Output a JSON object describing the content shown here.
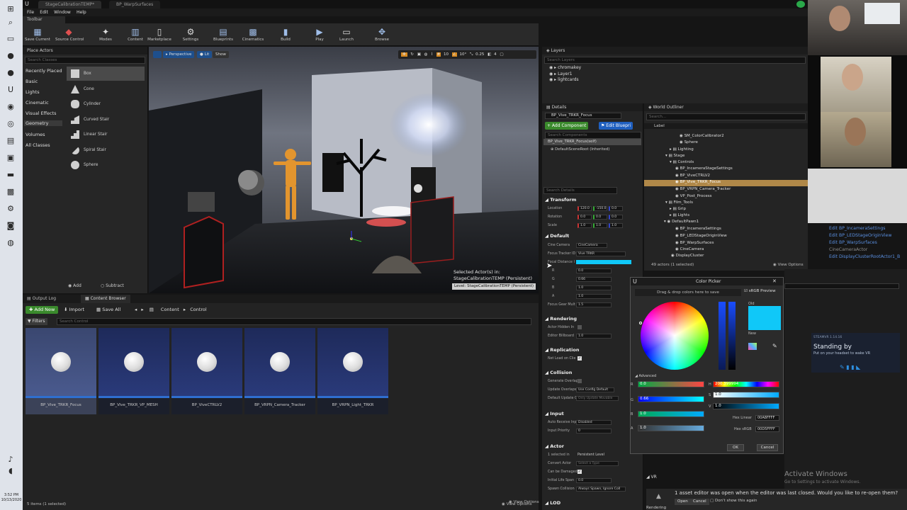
{
  "window": {
    "tabs": [
      "StageCalibrationTEMP*",
      "BP_WarpSurfaces"
    ],
    "menu": [
      "File",
      "Edit",
      "Window",
      "Help"
    ],
    "toolbar_tab": "Toolbar"
  },
  "toolbar": {
    "buttons": [
      "Save Current",
      "Source Control",
      "Modes",
      "Content",
      "Marketplace",
      "Settings",
      "Blueprints",
      "Cinematics",
      "Build",
      "Play",
      "Launch",
      "Browse"
    ]
  },
  "place_actors": {
    "title": "Place Actors",
    "search_placeholder": "Search Classes",
    "categories": [
      "Recently Placed",
      "Basic",
      "Lights",
      "Cinematic",
      "Visual Effects",
      "Geometry",
      "Volumes",
      "All Classes"
    ],
    "selected_category": "Geometry",
    "items": [
      "Box",
      "Cone",
      "Cylinder",
      "Curved Stair",
      "Linear Stair",
      "Spiral Stair",
      "Sphere"
    ],
    "add_label": "Add",
    "subtract_label": "Subtract"
  },
  "viewport": {
    "perspective": "Perspective",
    "lit": "Lit",
    "show": "Show",
    "grid_snap": "10",
    "rot_snap": "10°",
    "scale_snap": "0.25",
    "cam_speed": "4",
    "selected_label": "Selected Actor(s) in:",
    "selected_value": "StageCalibrationTEMP (Persistent)",
    "level_label": "Level: StageCalibrationTEMP (Persistent)"
  },
  "bottom": {
    "tabs": [
      "Output Log",
      "Content Browser"
    ],
    "add_new": "Add New",
    "import": "Import",
    "save_all": "Save All",
    "path": [
      "Content",
      "Control"
    ],
    "filters": "Filters",
    "search_placeholder": "Search Control",
    "assets": [
      "BP_Vive_TRKR_Focus",
      "BP_Vive_TRKR_VP_MESH",
      "BP_ViveCTRLV2",
      "BP_VRPN_Camera_Tracker",
      "BP_VRPN_Light_TRKR"
    ],
    "status": "5 items (1 selected)",
    "view_options": "View Options"
  },
  "layers": {
    "title": "Layers",
    "search_placeholder": "Search Layers",
    "items": [
      "chromakey",
      "Layer1",
      "lightcards"
    ]
  },
  "details": {
    "title": "Details",
    "actor_name": "BP_Vive_TRKR_Focus",
    "add_component": "+ Add Component",
    "edit_blueprint": "Edit Bluepri",
    "search_components": "Search Components",
    "self_row": "BP_Vive_TRKR_Focus(self)",
    "root_row": "DefaultSceneRoot (Inherited)",
    "search_details": "Search Details",
    "sections": [
      "Transform",
      "Default",
      "Rendering",
      "Replication",
      "Collision",
      "Input",
      "Actor",
      "LOD"
    ],
    "transform": {
      "labels": [
        "Location",
        "Rotation",
        "Scale"
      ],
      "location": [
        "120.0",
        "-150.0",
        "0.0"
      ],
      "rotation": [
        "0.0",
        "0.0",
        "0.0"
      ],
      "scale": [
        "1.0",
        "1.0",
        "1.0"
      ]
    },
    "default_props": {
      "cine_camera_label": "Cine Camera",
      "cine_camera": "CineCamera",
      "focus_tracker_label": "Focus Tracker ID",
      "focus_tracker": "Vive TRKR",
      "focal_distance_label": "Focal Distance I",
      "r": "0.0",
      "g": "0.66",
      "b": "1.0",
      "a": "1.0",
      "focus_gear_label": "Focus Gear Mult",
      "focus_gear": "1.5"
    },
    "rendering": {
      "actor_hidden": "Actor Hidden In",
      "editor_billboard": "Editor Billboard",
      "editor_billboard_val": "1.0"
    },
    "replication": {
      "net_load": "Net Load on Clie"
    },
    "collision": {
      "generate_overlap": "Generate Overlap",
      "update_overlaps": "Update Overlaps",
      "update_overlaps_val": "Use Config Default",
      "default_update": "Default Update C",
      "default_update_val": "Only Update Movable"
    },
    "input": {
      "auto_receive": "Auto Receive Inp",
      "auto_receive_val": "Disabled",
      "priority": "Input Priority",
      "priority_val": "0"
    },
    "actor": {
      "selected": "1 selected in",
      "selected_val": "Persistent Level",
      "convert": "Convert Actor",
      "convert_val": "Select a Type",
      "damaged": "Can be Damaged",
      "lifespan": "Initial Life Span",
      "lifespan_val": "0.0",
      "spawn": "Spawn Collision",
      "spawn_val": "Always Spawn, Ignore Coll"
    },
    "view_options": "View Options"
  },
  "outliner": {
    "title": "World Outliner",
    "search_placeholder": "Search...",
    "label_col": "Label",
    "items": [
      "SM_ColorCalibrator2",
      "Sphere",
      "Lighting",
      "Stage",
      "Controls",
      "BP_IncameraStageSettings",
      "BP_ViveCTRLV2",
      "BP_Vive_TRKR_Focus",
      "BP_VRPN_Camera_Tracker",
      "VP_Post_Process",
      "Film_Tools",
      "Grip",
      "Lights",
      "DefaultPawn1",
      "BP_IncameraSettings",
      "BP_LEDStageOriginView",
      "BP_WarpSurfaces",
      "CineCamera",
      "DisplayCluster"
    ],
    "status": "49 actors (1 selected)",
    "view_options": "View Options"
  },
  "edit_links": [
    "Edit BP_IncameraSettings",
    "Edit BP_LEDStageOriginView",
    "Edit BP_WarpSurfaces",
    "CineCameraActor",
    "Edit DisplayClusterRootActor1_B"
  ],
  "color_picker": {
    "title": "Color Picker",
    "hint": "Drag & drop colors here to save",
    "srgb_preview": "sRGB Preview",
    "old": "Old",
    "new": "New",
    "advanced": "Advanced",
    "r": "0.0",
    "g": "0.66",
    "b": "1.0",
    "a": "1.0",
    "h": "200.399994",
    "s": "1.0",
    "v": "1.0",
    "hex_linear_label": "Hex Linear",
    "hex_linear": "00A8FFFF",
    "hex_srgb_label": "Hex sRGB",
    "hex_srgb": "00D5FFFF",
    "ok": "OK",
    "cancel": "Cancel",
    "new_color": "#10c8f8"
  },
  "steamvr": {
    "version": "STEAMVR 1.14.16",
    "title": "Standing by",
    "subtitle": "Put on your headset to wake VR"
  },
  "activate": {
    "title": "Activate Windows",
    "subtitle": "Go to Settings to activate Windows."
  },
  "notification": {
    "text": "1 asset editor was open when the editor was last closed. Would you like to re-open them?",
    "open": "Open",
    "cancel": "Cancel",
    "dont_show": "Don't show this again"
  },
  "vr_label": "VR",
  "rendering_label": "Rendering",
  "clock": {
    "time": "3:52 PM",
    "date": "10/13/2020"
  }
}
